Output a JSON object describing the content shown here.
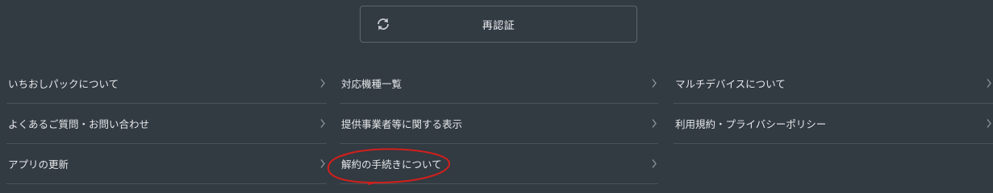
{
  "reauth": {
    "label": "再認証",
    "icon": "refresh-icon"
  },
  "menu": {
    "col1": [
      {
        "label": "いちおしパックについて"
      },
      {
        "label": "よくあるご質問・お問い合わせ"
      },
      {
        "label": "アプリの更新"
      }
    ],
    "col2": [
      {
        "label": "対応機種一覧"
      },
      {
        "label": "提供事業者等に関する表示"
      },
      {
        "label": "解約の手続きについて"
      }
    ],
    "col3": [
      {
        "label": "マルチデバイスについて"
      },
      {
        "label": "利用規約・プライバシーポリシー"
      }
    ]
  },
  "colors": {
    "background": "#323a42",
    "divider": "#4a525a",
    "annotation": "#d0201c"
  }
}
